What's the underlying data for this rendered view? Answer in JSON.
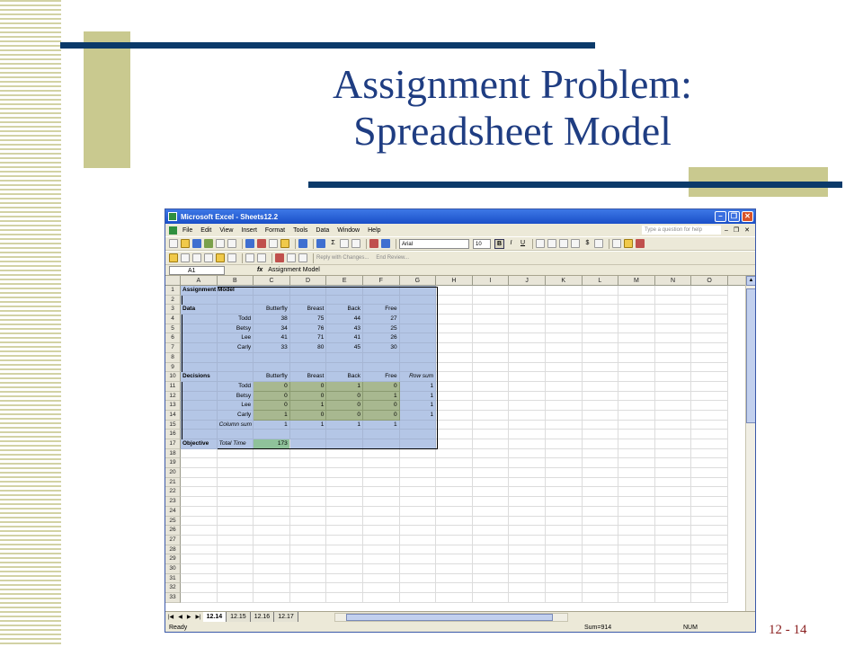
{
  "slide": {
    "title_line1": "Assignment Problem:",
    "title_line2": "Spreadsheet Model",
    "number": "12 - 14"
  },
  "window": {
    "title": "Microsoft Excel - Sheets12.2"
  },
  "menu": [
    "File",
    "Edit",
    "View",
    "Insert",
    "Format",
    "Tools",
    "Data",
    "Window",
    "Help"
  ],
  "help_placeholder": "Type a question for help",
  "toolbar": {
    "font": "Arial",
    "size": "10",
    "bold": "B",
    "italic": "I",
    "underline": "U",
    "currency": "$"
  },
  "toolbar2": {
    "reply": "Reply with Changes...",
    "end_review": "End Review..."
  },
  "formula_bar": {
    "name_box": "A1",
    "fx": "fx",
    "content": "Assignment Model"
  },
  "columns": [
    "A",
    "B",
    "C",
    "D",
    "E",
    "F",
    "G",
    "H",
    "I",
    "J",
    "K",
    "L",
    "M",
    "N",
    "O"
  ],
  "rows": [
    "1",
    "2",
    "3",
    "4",
    "5",
    "6",
    "7",
    "8",
    "9",
    "10",
    "11",
    "12",
    "13",
    "14",
    "15",
    "16",
    "17",
    "18",
    "19",
    "20",
    "21",
    "22",
    "23",
    "24",
    "25",
    "26",
    "27",
    "28",
    "29",
    "30",
    "31",
    "32",
    "33"
  ],
  "cells": {
    "r1": [
      "Assignment Model",
      "",
      "",
      "",
      "",
      "",
      ""
    ],
    "r2": [
      "",
      "",
      "",
      "",
      "",
      "",
      ""
    ],
    "r3": [
      "Data",
      "",
      "Butterfly",
      "Breast",
      "Back",
      "Free",
      ""
    ],
    "r4": [
      "",
      "Todd",
      "38",
      "75",
      "44",
      "27",
      ""
    ],
    "r5": [
      "",
      "Betsy",
      "34",
      "76",
      "43",
      "25",
      ""
    ],
    "r6": [
      "",
      "Lee",
      "41",
      "71",
      "41",
      "26",
      ""
    ],
    "r7": [
      "",
      "Carly",
      "33",
      "80",
      "45",
      "30",
      ""
    ],
    "r8": [
      "",
      "",
      "",
      "",
      "",
      "",
      ""
    ],
    "r9": [
      "",
      "",
      "",
      "",
      "",
      "",
      ""
    ],
    "r10": [
      "Decisions",
      "",
      "Butterfly",
      "Breast",
      "Back",
      "Free",
      "Row sum"
    ],
    "r11": [
      "",
      "Todd",
      "0",
      "0",
      "1",
      "0",
      "1"
    ],
    "r12": [
      "",
      "Betsy",
      "0",
      "0",
      "0",
      "1",
      "1"
    ],
    "r13": [
      "",
      "Lee",
      "0",
      "1",
      "0",
      "0",
      "1"
    ],
    "r14": [
      "",
      "Carly",
      "1",
      "0",
      "0",
      "0",
      "1"
    ],
    "r15": [
      "",
      "Column sum",
      "1",
      "1",
      "1",
      "1",
      ""
    ],
    "r16": [
      "",
      "",
      "",
      "",
      "",
      "",
      ""
    ],
    "r17": [
      "Objective",
      "Total Time",
      "173",
      "",
      "",
      "",
      ""
    ]
  },
  "sheet_tabs": [
    "12.14",
    "12.15",
    "12.16",
    "12.17"
  ],
  "status": {
    "ready": "Ready",
    "sum": "Sum=914",
    "num": "NUM"
  },
  "colors": {
    "title": "#1f3d82",
    "accent_line": "#0b3a6a",
    "accent_block": "#c9c98f",
    "changing_cells": "#a8b890",
    "objective_cell": "#8fc29a",
    "selection": "#b4c6e6"
  }
}
